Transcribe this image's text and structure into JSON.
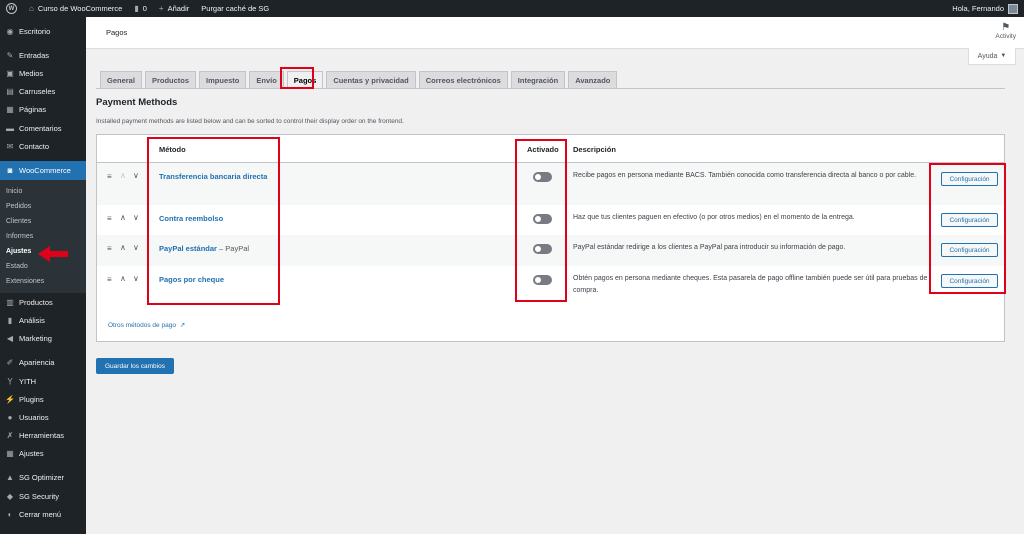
{
  "adminbar": {
    "site_name": "Curso de WooCommerce",
    "comments_count": "0",
    "add_label": "Añadir",
    "purge_label": "Purgar caché de SG",
    "greeting": "Hola, Fernando"
  },
  "sidebar": {
    "items_top": [
      {
        "label": "Escritorio",
        "icon": "dashboard-icon"
      },
      {
        "label": "Entradas",
        "icon": "pin-icon"
      },
      {
        "label": "Medios",
        "icon": "media-icon"
      },
      {
        "label": "Carruseles",
        "icon": "carousel-icon"
      },
      {
        "label": "Páginas",
        "icon": "pages-icon"
      },
      {
        "label": "Comentarios",
        "icon": "comments-icon"
      },
      {
        "label": "Contacto",
        "icon": "mail-icon"
      }
    ],
    "active": {
      "label": "WooCommerce",
      "icon": "woo-icon"
    },
    "submenu": [
      "Inicio",
      "Pedidos",
      "Clientes",
      "Informes",
      "Ajustes",
      "Estado",
      "Extensiones"
    ],
    "submenu_current": "Ajustes",
    "items_bottom": [
      {
        "label": "Productos",
        "icon": "products-icon"
      },
      {
        "label": "Análisis",
        "icon": "analytics-icon"
      },
      {
        "label": "Marketing",
        "icon": "marketing-icon"
      },
      {
        "label": "Apariencia",
        "icon": "brush-icon"
      },
      {
        "label": "YITH",
        "icon": "yith-icon"
      },
      {
        "label": "Plugins",
        "icon": "plugin-icon"
      },
      {
        "label": "Usuarios",
        "icon": "users-icon"
      },
      {
        "label": "Herramientas",
        "icon": "tools-icon"
      },
      {
        "label": "Ajustes",
        "icon": "settings-icon"
      },
      {
        "label": "SG Optimizer",
        "icon": "sg-optimizer-icon"
      },
      {
        "label": "SG Security",
        "icon": "sg-security-icon"
      },
      {
        "label": "Cerrar menú",
        "icon": "collapse-icon"
      }
    ]
  },
  "header": {
    "title": "Pagos",
    "activity": "Activity",
    "help": "Ayuda"
  },
  "tabs": [
    {
      "label": "General"
    },
    {
      "label": "Productos"
    },
    {
      "label": "Impuesto"
    },
    {
      "label": "Envío"
    },
    {
      "label": "Pagos"
    },
    {
      "label": "Cuentas y privacidad"
    },
    {
      "label": "Correos electrónicos"
    },
    {
      "label": "Integración"
    },
    {
      "label": "Avanzado"
    }
  ],
  "active_tab": "Pagos",
  "section": {
    "title": "Payment Methods",
    "description": "Installed payment methods are listed below and can be sorted to control their display order on the frontend."
  },
  "table": {
    "headers": {
      "method": "Método",
      "enabled": "Activado",
      "description": "Descripción"
    },
    "rows": [
      {
        "method": "Transferencia bancaria directa",
        "method_sub": "",
        "enabled": false,
        "description": "Recibe pagos en persona mediante BACS. También conocida como transferencia directa al banco o por cable.",
        "button": "Configuración"
      },
      {
        "method": "Contra reembolso",
        "method_sub": "",
        "enabled": false,
        "description": "Haz que tus clientes paguen en efectivo (o por otros medios) en el momento de la entrega.",
        "button": "Configuración"
      },
      {
        "method": "PayPal estándar",
        "method_sub": " – PayPal",
        "enabled": false,
        "description": "PayPal estándar redirige a los clientes a PayPal para introducir su información de pago.",
        "button": "Configuración"
      },
      {
        "method": "Pagos por cheque",
        "method_sub": "",
        "enabled": false,
        "description": "Obtén pagos en persona mediante cheques. Esta pasarela de pago offline también puede ser útil para pruebas de compra.",
        "button": "Configuración"
      }
    ],
    "other_methods": "Otros métodos de pago"
  },
  "save_button": "Guardar los cambios",
  "colors": {
    "accent": "#2271b1",
    "highlight": "#e0001a",
    "sidebar": "#1d2327"
  }
}
